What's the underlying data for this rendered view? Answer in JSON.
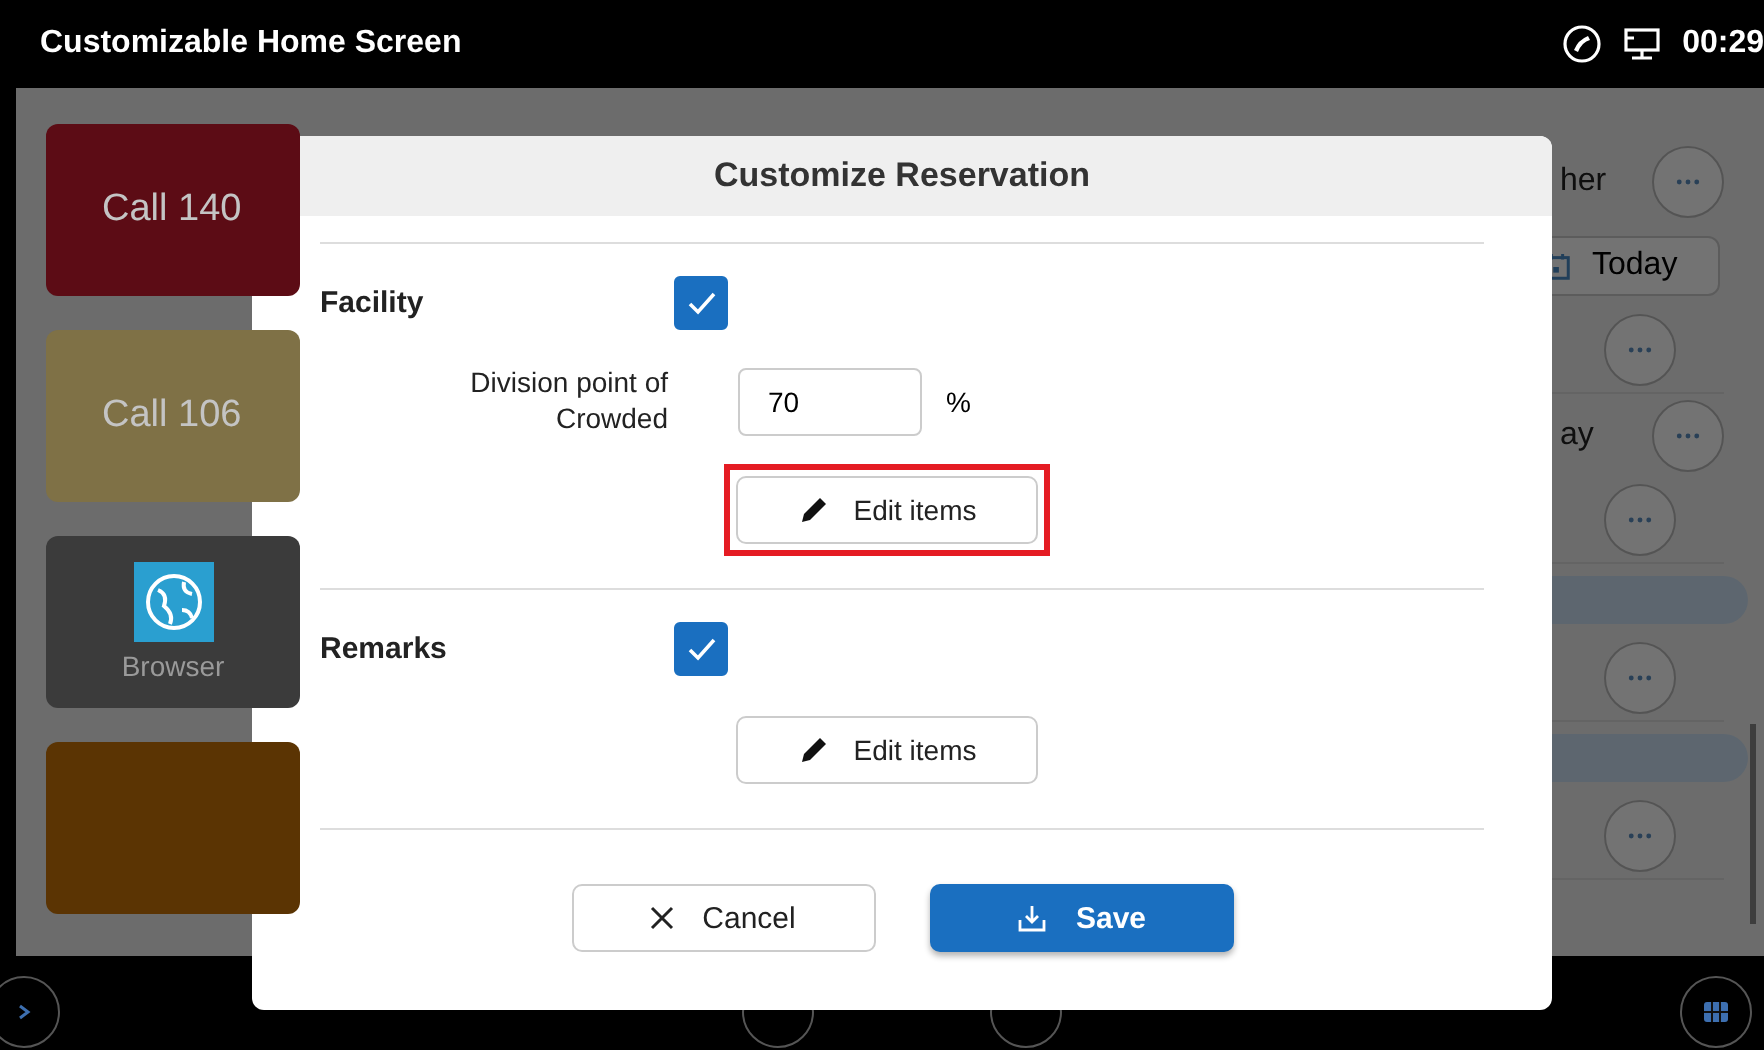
{
  "status_bar": {
    "title": "Customizable Home Screen",
    "time": "00:29"
  },
  "tiles": [
    {
      "label": "Call 140",
      "color": "#5c0c15",
      "kind": "text"
    },
    {
      "label": "Call 106",
      "color": "#7f7146",
      "kind": "text"
    },
    {
      "label": "Browser",
      "color": "#3b3b3b",
      "kind": "app"
    },
    {
      "color": "#5b3403",
      "kind": "blank"
    }
  ],
  "side_list": [
    {
      "kind": "text",
      "label": "her"
    },
    {
      "kind": "date",
      "label": "Today"
    },
    {
      "kind": "more"
    },
    {
      "kind": "text",
      "label": "ay"
    },
    {
      "kind": "more"
    },
    {
      "kind": "bar"
    },
    {
      "kind": "more"
    },
    {
      "kind": "bar"
    },
    {
      "kind": "more"
    }
  ],
  "dialog": {
    "title": "Customize Reservation",
    "sections": [
      {
        "label": "Facility",
        "checked": true,
        "fields": [
          {
            "label": "Division point of Crowded",
            "value": "70",
            "unit": "%"
          }
        ],
        "button": {
          "label": "Edit items",
          "highlighted": true
        }
      },
      {
        "label": "Remarks",
        "checked": true,
        "button": {
          "label": "Edit items",
          "highlighted": false
        }
      }
    ],
    "cancel": "Cancel",
    "save": "Save"
  }
}
